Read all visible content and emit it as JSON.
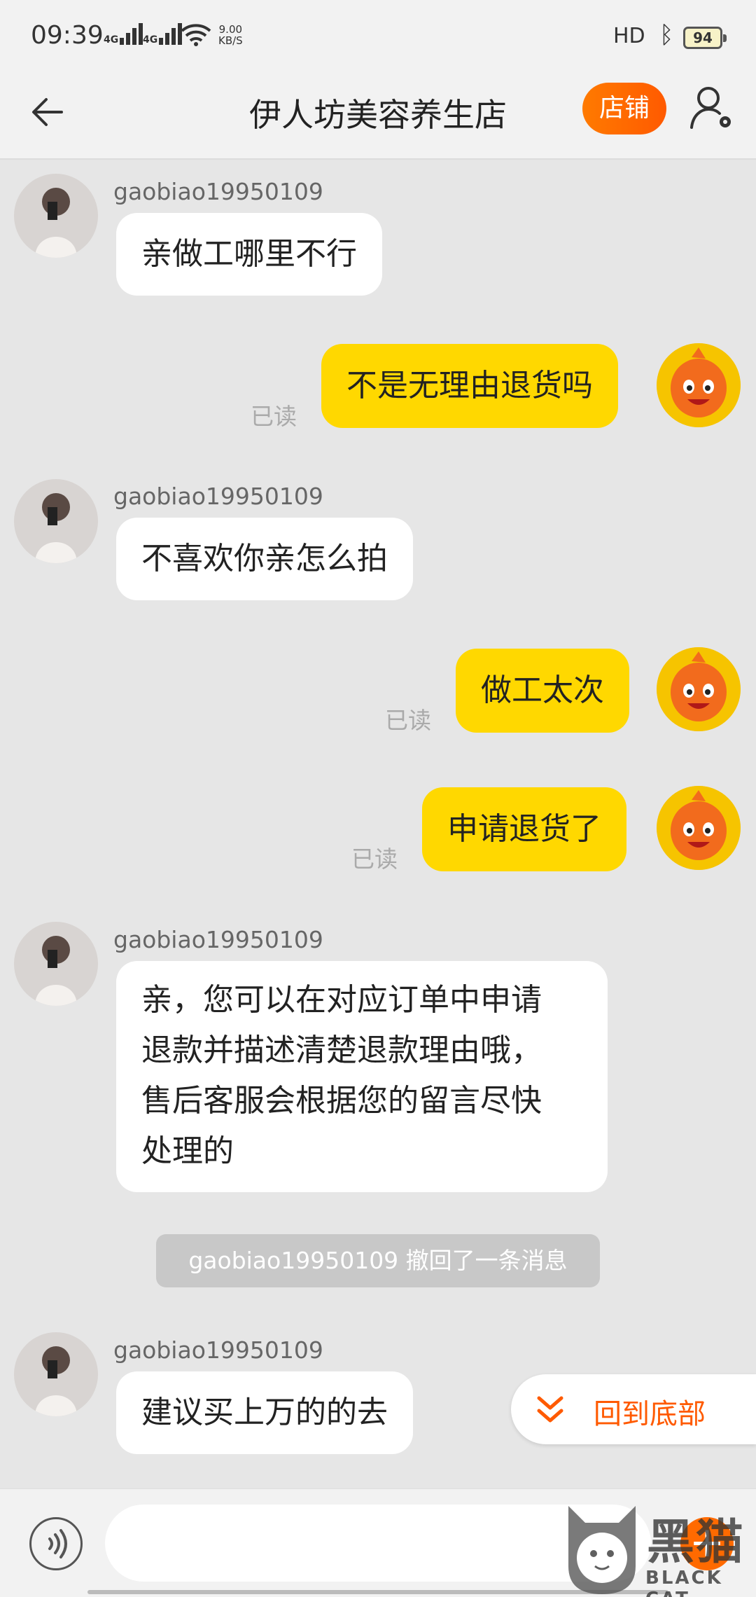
{
  "status_bar": {
    "time": "09:39",
    "network_1": "4G",
    "network_2": "4G",
    "speed_value": "9.00",
    "speed_unit": "KB/S",
    "hd": "HD",
    "battery": "94"
  },
  "header": {
    "title": "伊人坊美容养生店",
    "store_label": "店铺"
  },
  "messages": [
    {
      "side": "left",
      "sender": "gaobiao19950109",
      "text": "亲做工哪里不行"
    },
    {
      "side": "right",
      "text": "不是无理由退货吗",
      "status": "已读"
    },
    {
      "side": "left",
      "sender": "gaobiao19950109",
      "text": "不喜欢你亲怎么拍"
    },
    {
      "side": "right",
      "text": "做工太次",
      "status": "已读"
    },
    {
      "side": "right",
      "text": "申请退货了",
      "status": "已读"
    },
    {
      "side": "left",
      "sender": "gaobiao19950109",
      "lines": [
        "亲，您可以在对应订单中申请",
        "退款并描述清楚退款理由哦，",
        "售后客服会根据您的留言尽快",
        "处理的"
      ]
    },
    {
      "side": "left",
      "sender": "gaobiao19950109",
      "text": "建议买上万的的去"
    }
  ],
  "recall_notice": "gaobiao19950109 撤回了一条消息",
  "back_to_bottom": "回到底部",
  "input": {
    "placeholder": ""
  },
  "watermark": {
    "title": "黑猫",
    "subtitle": "BLACK CAT"
  },
  "colors": {
    "accent": "#ff5a00",
    "my_bubble": "#ffd800",
    "their_bubble": "#ffffff",
    "background": "#e6e6e6"
  }
}
